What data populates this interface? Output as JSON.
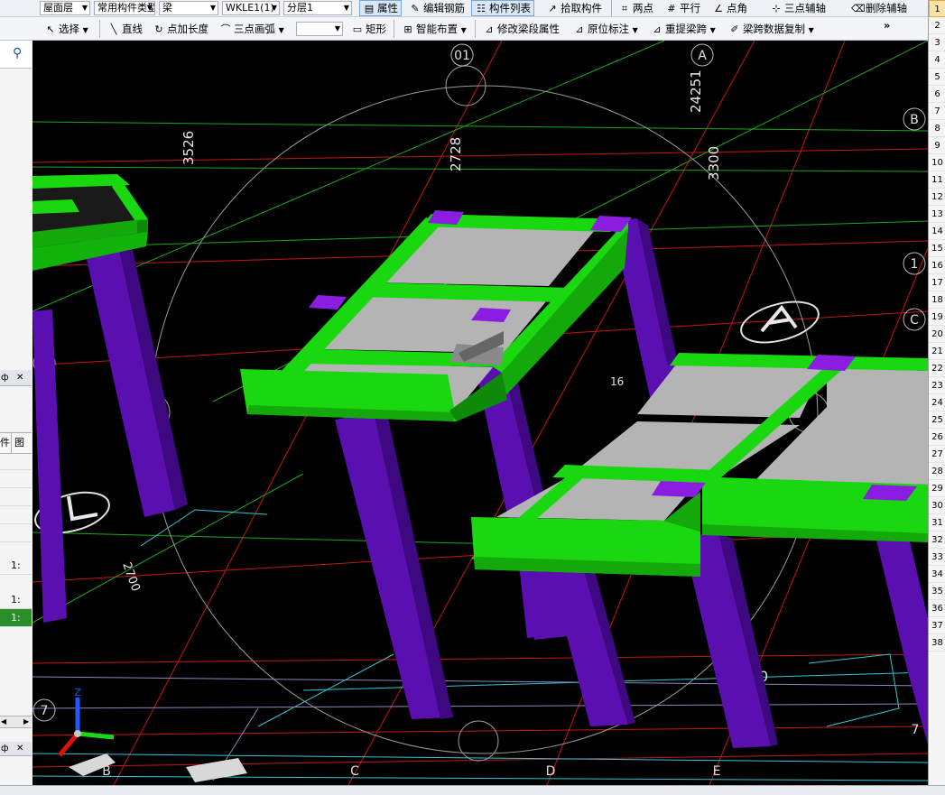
{
  "toolbar1": {
    "floor": "屋面层",
    "category": "常用构件类型",
    "component": "梁",
    "instance": "WKLE1(1)",
    "layer": "分层1",
    "btn_property": "属性",
    "btn_edit_rebar": "编辑钢筋",
    "btn_component_list": "构件列表",
    "btn_pick": "拾取构件",
    "btn_two_point": "两点",
    "btn_parallel": "平行",
    "btn_point_angle": "点角",
    "btn_three_point_aux": "三点辅轴",
    "btn_delete_aux": "删除辅轴"
  },
  "toolbar2": {
    "select": "选择",
    "line": "直线",
    "point_length": "点加长度",
    "arc3": "三点画弧",
    "rect": "矩形",
    "smart_layout": "智能布置",
    "modify_span": "修改梁段属性",
    "original_mark": "原位标注",
    "respan": "重提梁跨",
    "span_copy": "梁跨数据复制",
    "more": "»"
  },
  "left_panel": {
    "search_icon": "search-icon",
    "pin_label": "ф",
    "close_label": "✕",
    "col_a": "件",
    "col_b": "图",
    "cell1": "1:",
    "cell2": "1:",
    "cell3": "1:"
  },
  "right_rows": [
    "1",
    "2",
    "3",
    "4",
    "5",
    "6",
    "7",
    "8",
    "9",
    "10",
    "11",
    "12",
    "13",
    "14",
    "15",
    "16",
    "17",
    "18",
    "19",
    "20",
    "21",
    "22",
    "23",
    "24",
    "25",
    "26",
    "27",
    "28",
    "29",
    "30",
    "31",
    "32",
    "33",
    "34",
    "35",
    "36",
    "37",
    "38"
  ],
  "viewport": {
    "grid_labels": {
      "g01": "01",
      "gA": "A",
      "gB": "B",
      "g1": "1",
      "gC": "C",
      "g2": "2",
      "g7": "7",
      "gBb": "B",
      "gCb": "C",
      "gDb": "D",
      "gEb": "E",
      "g7b": "7",
      "g01b": "01"
    },
    "dims": {
      "d1": "3526",
      "d2": "2728",
      "d3": "3300",
      "d4": "24251",
      "d5": "2700",
      "d6": "16",
      "d7": "0"
    }
  },
  "colors": {
    "beam": "#19d80f",
    "column": "#5a0fb0",
    "slab": "#b4b4b4",
    "joint": "#8a1de0"
  }
}
